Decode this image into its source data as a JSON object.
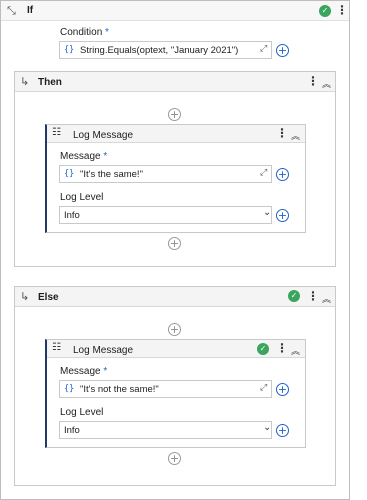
{
  "if_block": {
    "title": "If",
    "condition_label": "Condition",
    "required_mark": "*",
    "condition_value": "String.Equals(optext, \"January 2021\")",
    "expr_icon": "{}"
  },
  "then_block": {
    "title": "Then",
    "activity": {
      "title": "Log Message",
      "message_label": "Message",
      "required_mark": "*",
      "message_value": "\"It's the same!\"",
      "expr_icon": "{}",
      "level_label": "Log Level",
      "level_value": "Info"
    }
  },
  "else_block": {
    "title": "Else",
    "activity": {
      "title": "Log Message",
      "message_label": "Message",
      "required_mark": "*",
      "message_value": "\"It's not the same!\"",
      "expr_icon": "{}",
      "level_label": "Log Level",
      "level_value": "Info"
    }
  },
  "icons": {
    "plus": "+",
    "kebab": "⋮",
    "collapse": "︽",
    "check": "✓",
    "expand": "⤢",
    "dropdown": "⌄",
    "branch": "↳"
  },
  "colors": {
    "accent_blue": "#1e64c8",
    "success_green": "#3aa55c",
    "activity_accent": "#1f3a68"
  }
}
